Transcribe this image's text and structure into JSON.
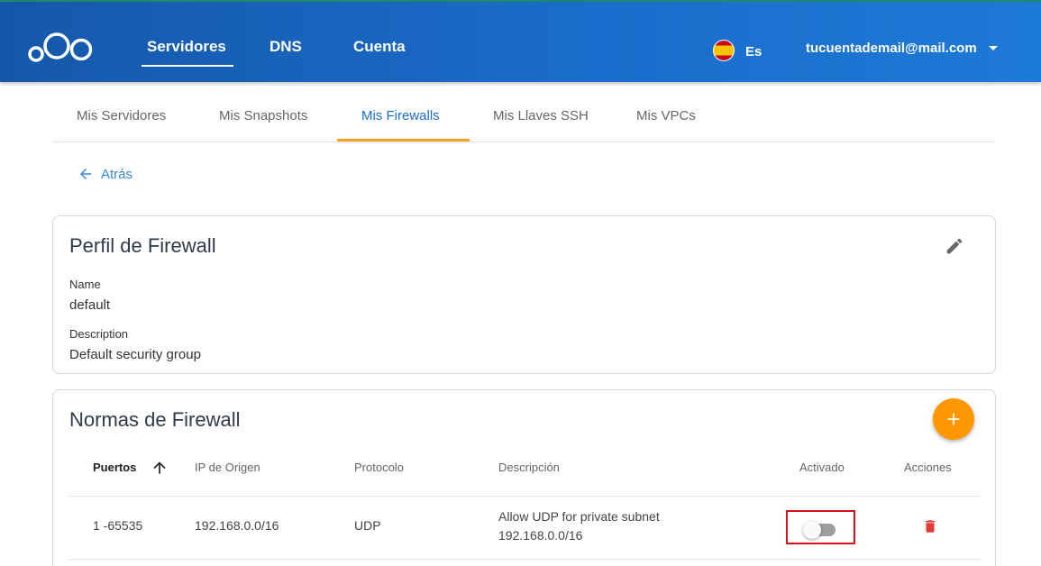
{
  "header": {
    "nav": [
      {
        "label": "Servidores"
      },
      {
        "label": "DNS"
      },
      {
        "label": "Cuenta"
      }
    ],
    "language": "Es",
    "account_email": "tucuentademail@mail.com"
  },
  "tabs": [
    {
      "label": "Mis Servidores"
    },
    {
      "label": "Mis Snapshots"
    },
    {
      "label": "Mis Firewalls",
      "active": true
    },
    {
      "label": "Mis Llaves SSH"
    },
    {
      "label": "Mis VPCs"
    }
  ],
  "back_label": "Atrás",
  "profile": {
    "title": "Perfil de Firewall",
    "name_label": "Name",
    "name_value": "default",
    "description_label": "Description",
    "description_value": "Default security group"
  },
  "rules": {
    "title": "Normas de Firewall",
    "columns": [
      "Puertos",
      "IP de Origen",
      "Protocolo",
      "Descripción",
      "Activado",
      "Acciones"
    ],
    "rows": [
      {
        "ports": "1 -65535",
        "source_ip": "192.168.0.0/16",
        "protocol": "UDP",
        "description_line1": "Allow UDP for private subnet",
        "description_line2": "192.168.0.0/16",
        "enabled": false
      }
    ]
  },
  "colors": {
    "header_bg": "#1a6ccb",
    "accent_orange": "#ff9800",
    "tab_active": "#1b6fcf",
    "tab_underline": "#f5a623",
    "delete_red": "#e53935",
    "highlight_box": "#d4101a"
  },
  "icons": [
    "logo-icon",
    "flag-es-icon",
    "chevron-down-icon",
    "arrow-left-icon",
    "pencil-icon",
    "plus-icon",
    "arrow-up-icon",
    "trash-icon"
  ]
}
